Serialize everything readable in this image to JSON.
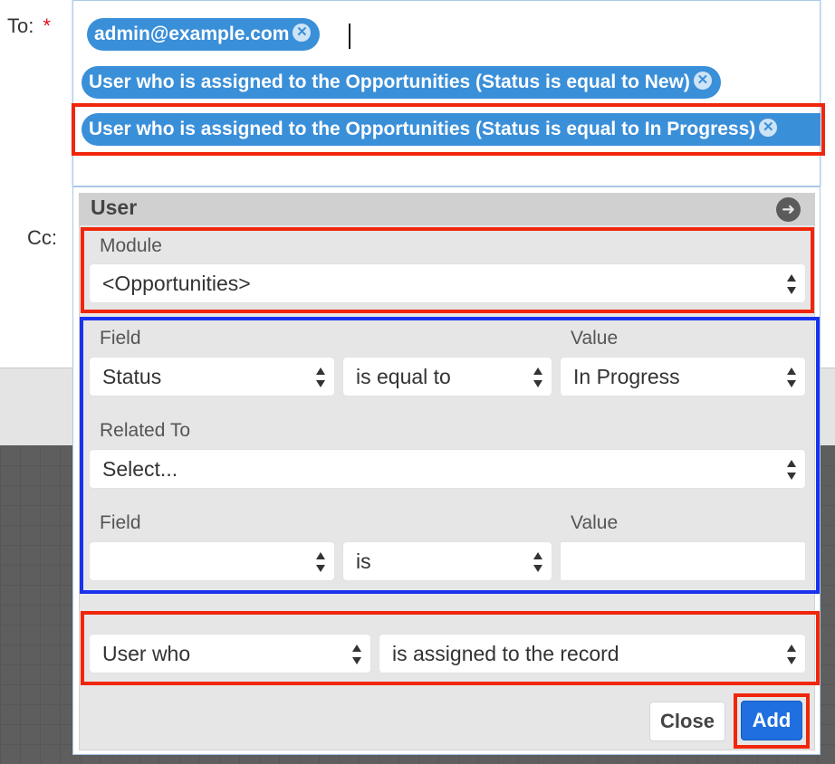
{
  "form": {
    "to_label": "To:",
    "required_mark": "*",
    "cc_label": "Cc:"
  },
  "recipients": [
    {
      "label": "admin@example.com",
      "remove_icon": "close-circle-icon"
    },
    {
      "label": "User who is assigned to the Opportunities (Status is equal to New)",
      "remove_icon": "close-circle-icon"
    },
    {
      "label": "User who is assigned to the Opportunities (Status is equal to In Progress)",
      "remove_icon": "close-circle-icon"
    }
  ],
  "panel": {
    "title": "User",
    "back_icon": "arrow-left-circle-icon",
    "module_label": "Module",
    "module_value": "<Opportunities>",
    "filter": {
      "field_label": "Field",
      "value_label": "Value",
      "field_value": "Status",
      "operator_value": "is equal to",
      "value_value": "In Progress",
      "related_label": "Related To",
      "related_value": "Select...",
      "field2_label": "Field",
      "value2_label": "Value",
      "field2_value": "",
      "operator2_value": "is",
      "value2_value": ""
    },
    "user_who_value": "User who",
    "relation_value": "is assigned to the record",
    "close_label": "Close",
    "add_label": "Add"
  },
  "colors": {
    "pill": "#3a8fd9",
    "highlight_red": "#f0260a",
    "highlight_blue": "#1932f0",
    "add_button": "#1f6fe0"
  }
}
